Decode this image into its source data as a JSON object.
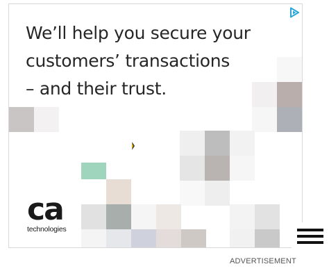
{
  "ad": {
    "headline_lines": [
      "We’ll help you secure your",
      "customers’ transactions",
      "– and their trust."
    ],
    "brand": {
      "mark": "ca",
      "subtitle": "technologies"
    },
    "adchoices_icon": "adchoices-triangle-icon",
    "accent_color": "#2aa6d6"
  },
  "menu": {
    "icon": "hamburger-menu-icon"
  },
  "footer": {
    "label": "ADVERTISEMENT"
  }
}
